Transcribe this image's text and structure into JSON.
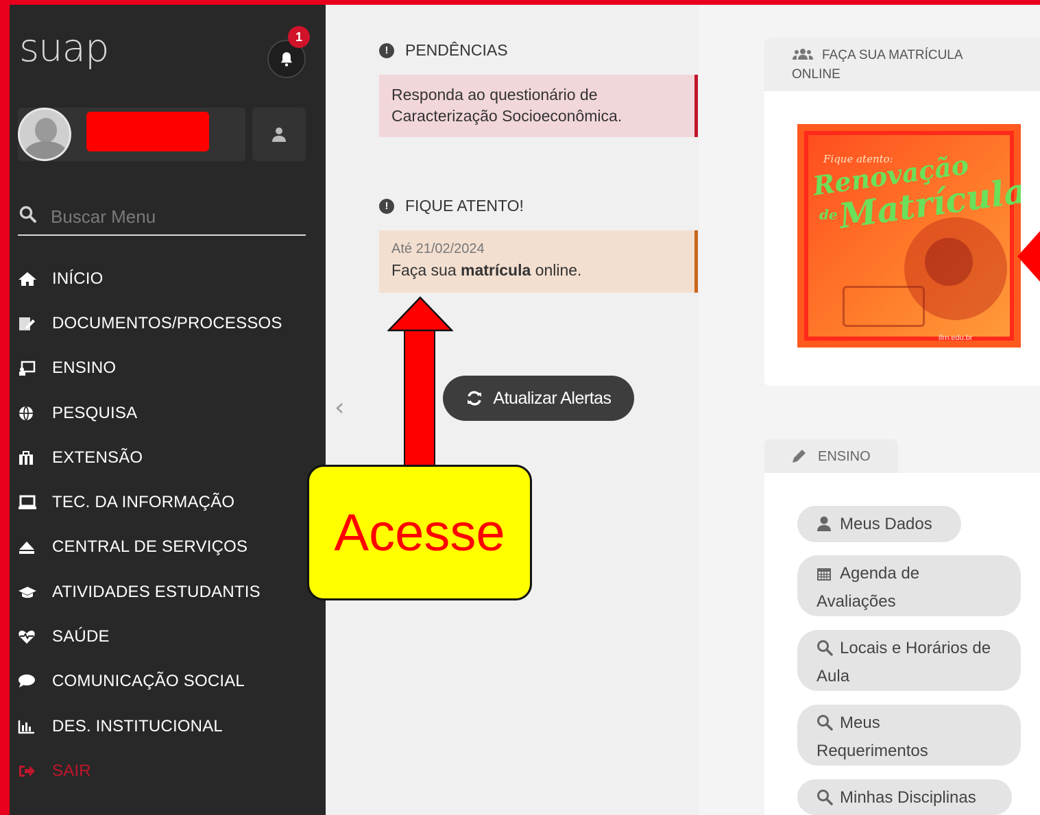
{
  "app": {
    "logo": "suap",
    "notification_count": "1"
  },
  "search": {
    "placeholder": "Buscar Menu"
  },
  "menu": {
    "items": [
      {
        "label": "INÍCIO",
        "icon": "home-icon"
      },
      {
        "label": "DOCUMENTOS/PROCESSOS",
        "icon": "document-edit-icon"
      },
      {
        "label": "ENSINO",
        "icon": "chalkboard-icon"
      },
      {
        "label": "PESQUISA",
        "icon": "globe-icon"
      },
      {
        "label": "EXTENSÃO",
        "icon": "building-icon"
      },
      {
        "label": "TEC. DA INFORMAÇÃO",
        "icon": "laptop-icon"
      },
      {
        "label": "CENTRAL DE SERVIÇOS",
        "icon": "eject-icon"
      },
      {
        "label": "ATIVIDADES ESTUDANTIS",
        "icon": "graduation-cap-icon"
      },
      {
        "label": "SAÚDE",
        "icon": "heartbeat-icon"
      },
      {
        "label": "COMUNICAÇÃO SOCIAL",
        "icon": "comment-icon"
      },
      {
        "label": "DES. INSTITUCIONAL",
        "icon": "bar-chart-icon"
      },
      {
        "label": "SAIR",
        "icon": "sign-out-icon"
      }
    ]
  },
  "alerts": {
    "pendencias_title": "PENDÊNCIAS",
    "pendencias_text": "Responda ao questionário de Caracterização Socioeconômica.",
    "attention_title": "FIQUE ATENTO!",
    "attention_date": "Até 21/02/2024",
    "attention_text_pre": "Faça sua ",
    "attention_text_bold": "matrícula",
    "attention_text_post": " online.",
    "refresh_label": "Atualizar Alertas"
  },
  "main": {
    "card1_title_line1": "FAÇA SUA MATRÍCULA",
    "card1_title_line2": "ONLINE",
    "banner_small": "Fique atento:",
    "banner_line1": "Renovação",
    "banner_de": "de",
    "banner_line2": "Matrícula",
    "banner_site": "ifrn.edu.br",
    "ensino_tab": "ENSINO",
    "ensino_links": [
      {
        "label": "Meus Dados",
        "icon": "user-icon"
      },
      {
        "label": "Agenda de Avaliações",
        "icon": "calendar-icon"
      },
      {
        "label": "Locais e Horários de Aula",
        "icon": "search-icon"
      },
      {
        "label": "Meus Requerimentos",
        "icon": "search-icon"
      },
      {
        "label": "Minhas Disciplinas",
        "icon": "search-icon"
      }
    ]
  },
  "annotation": {
    "callout_text": "Acesse"
  },
  "colors": {
    "sidebar": "#282828",
    "accent_red": "#c0162b",
    "callout_bg": "#ffff00",
    "annotation_red": "#ff0000"
  }
}
